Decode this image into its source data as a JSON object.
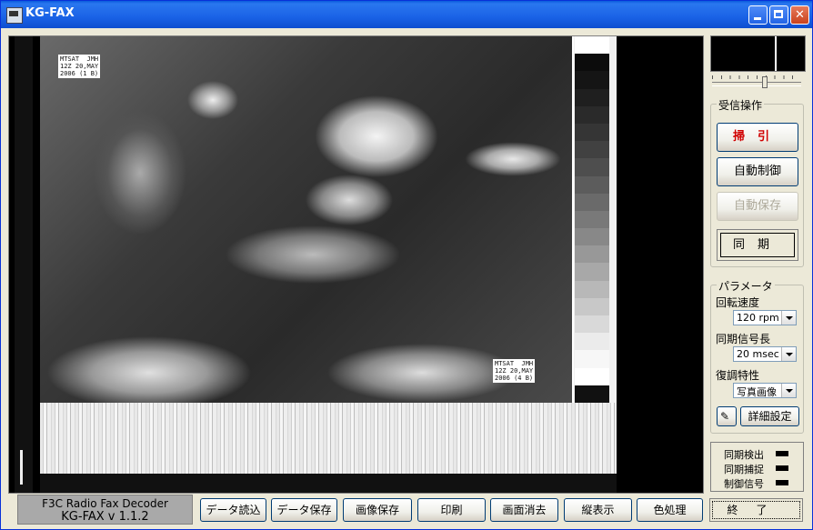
{
  "window": {
    "title": "KG-FAX"
  },
  "stamps": {
    "top_left": "MTSAT  JMH\n12Z 20,MAY\n2006 (1 B)",
    "bottom_right": "MTSAT  JMH\n12Z 20,MAY\n2006 (4 B)"
  },
  "grayscale": [
    "#ffffff",
    "#0c0c0c",
    "#151515",
    "#1f1f1f",
    "#2a2a2a",
    "#353535",
    "#414141",
    "#4e4e4e",
    "#5c5c5c",
    "#6a6a6a",
    "#797979",
    "#888888",
    "#989898",
    "#a8a8a8",
    "#b8b8b8",
    "#c8c8c8",
    "#d9d9d9",
    "#ebebeb",
    "#f7f7f7",
    "#ffffff",
    "#111111"
  ],
  "receive_group": {
    "legend": "受信操作",
    "sweep": "掃引",
    "auto_control": "自動制御",
    "auto_save": "自動保存",
    "sync": "同期"
  },
  "params_group": {
    "legend": "パラメータ",
    "rotation_label": "回転速度",
    "rotation_value": "120 rpm",
    "sync_len_label": "同期信号長",
    "sync_len_value": "20 msec",
    "demod_label": "復調特性",
    "demod_value": "写真画像",
    "detail_button": "詳細設定"
  },
  "status": {
    "sync_detect": "同期検出",
    "sync_capture": "同期捕捉",
    "control_signal": "制御信号"
  },
  "version": {
    "line1": "F3C Radio Fax Decoder",
    "line2": "KG-FAX  v 1.1.2"
  },
  "bottom_buttons": {
    "read_data": "データ読込",
    "save_data": "データ保存",
    "save_image": "画像保存",
    "print": "印刷",
    "clear": "画面消去",
    "vertical": "縦表示",
    "color": "色処理",
    "exit": "終了"
  }
}
